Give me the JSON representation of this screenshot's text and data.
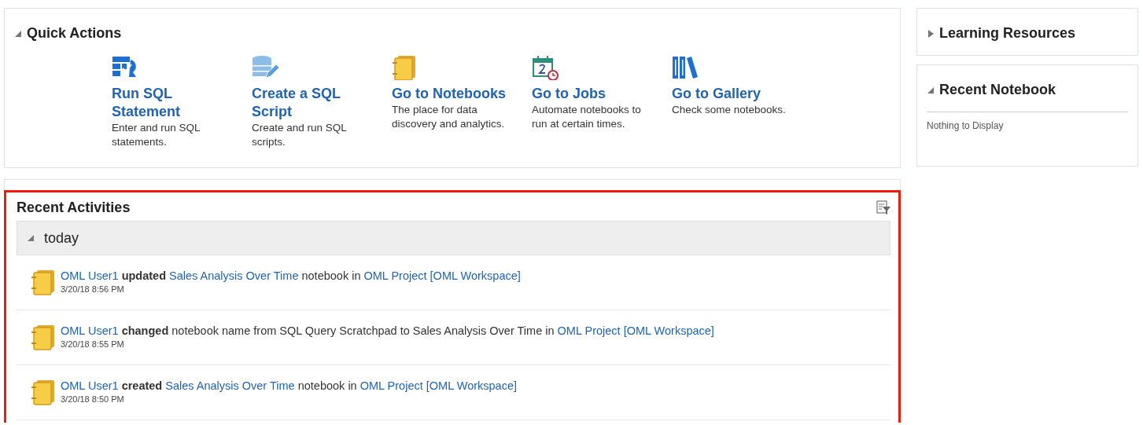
{
  "quick_actions": {
    "title": "Quick Actions",
    "expanded": true,
    "actions": [
      {
        "kind": "sql",
        "title": "Run SQL Statement",
        "description": "Enter and run SQL statements."
      },
      {
        "kind": "script",
        "title": "Create a SQL Script",
        "description": "Create and run SQL scripts."
      },
      {
        "kind": "notebook",
        "title": "Go to Notebooks",
        "description": "The place for data discovery and analytics."
      },
      {
        "kind": "jobs",
        "title": "Go to Jobs",
        "description": "Automate notebooks to run at certain times."
      },
      {
        "kind": "gallery",
        "title": "Go to Gallery",
        "description": "Check some notebooks."
      }
    ]
  },
  "recent_activities": {
    "title": "Recent Activities",
    "groups": [
      {
        "label": "today",
        "expanded": true,
        "items": [
          {
            "parts": [
              {
                "kind": "link",
                "text": "OML User1"
              },
              {
                "kind": "bold",
                "text": "updated"
              },
              {
                "kind": "link",
                "text": "Sales Analysis Over Time"
              },
              {
                "kind": "text",
                "text": "notebook in"
              },
              {
                "kind": "link",
                "text": "OML Project [OML Workspace]"
              }
            ],
            "time": "3/20/18 8:56 PM"
          },
          {
            "parts": [
              {
                "kind": "link",
                "text": "OML User1"
              },
              {
                "kind": "bold",
                "text": "changed"
              },
              {
                "kind": "text",
                "text": "notebook name from SQL Query Scratchpad to Sales Analysis Over Time in"
              },
              {
                "kind": "link",
                "text": "OML Project [OML Workspace]"
              }
            ],
            "time": "3/20/18 8:55 PM"
          },
          {
            "parts": [
              {
                "kind": "link",
                "text": "OML User1"
              },
              {
                "kind": "bold",
                "text": "created"
              },
              {
                "kind": "link",
                "text": "Sales Analysis Over Time"
              },
              {
                "kind": "text",
                "text": "notebook in"
              },
              {
                "kind": "link",
                "text": "OML Project [OML Workspace]"
              }
            ],
            "time": "3/20/18 8:50 PM"
          }
        ]
      }
    ]
  },
  "learning_resources": {
    "title": "Learning Resources",
    "expanded": false
  },
  "recent_notebook": {
    "title": "Recent Notebook",
    "expanded": true,
    "empty_text": "Nothing to Display"
  }
}
